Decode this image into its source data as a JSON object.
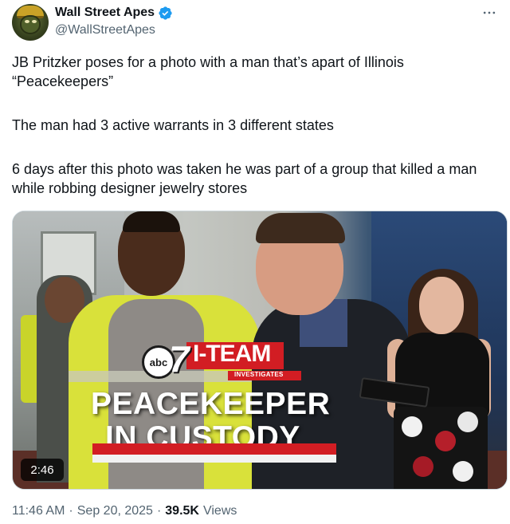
{
  "author": {
    "display_name": "Wall Street Apes",
    "handle": "@WallStreetApes",
    "verified": true,
    "verified_color": "#1d9bf0"
  },
  "more_icon": "more-horizontal-icon",
  "tweet": {
    "paragraphs": [
      "JB Pritzker poses for a photo with a man that’s apart of Illinois “Peacekeepers”",
      "The man had 3 active warrants in 3 different states",
      "6 days after this photo was taken he was part of a group that killed a man while robbing designer jewelry stores"
    ]
  },
  "media": {
    "type": "video",
    "duration": "2:46",
    "overlay": {
      "network_logo_text": "abc",
      "channel_number": "7",
      "segment": "I-TEAM",
      "segment_sub": "INVESTIGATES",
      "headline_line1": "PEACEKEEPER",
      "headline_line2": "IN CUSTODY"
    },
    "accent_color": "#d21d23"
  },
  "meta": {
    "time": "11:46 AM",
    "separator": "·",
    "date": "Sep 20, 2025",
    "views_count": "39.5K",
    "views_label": "Views"
  }
}
